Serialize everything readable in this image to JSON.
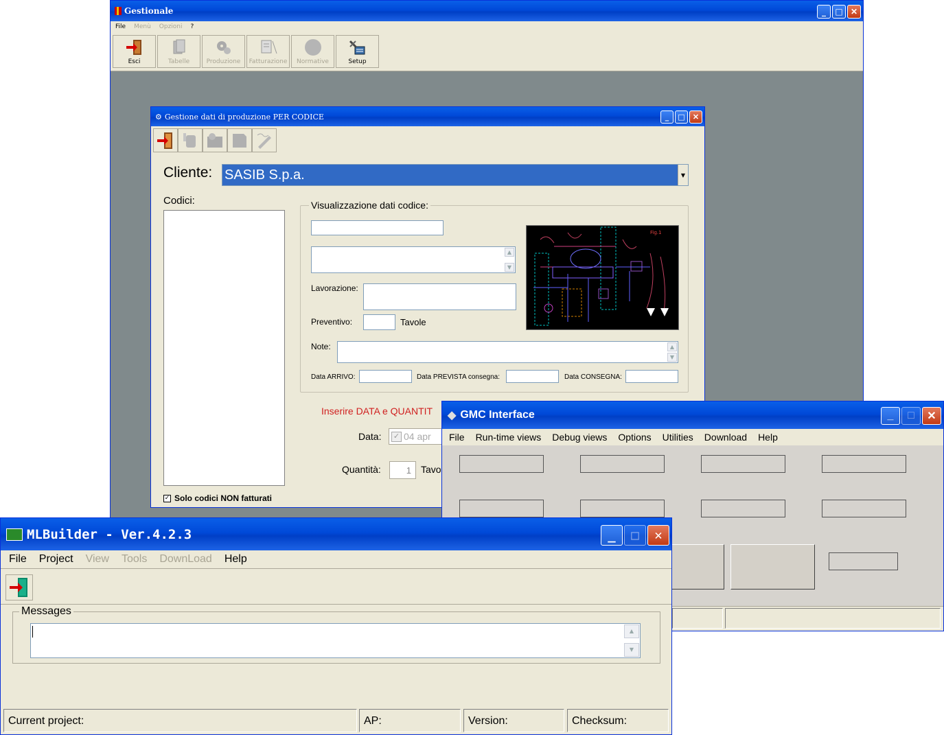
{
  "gestionale": {
    "title": "Gestionale",
    "menu": [
      "File",
      "Menù",
      "Opzioni",
      "?"
    ],
    "toolbar": [
      "Esci",
      "Tabelle",
      "Produzione",
      "Fatturazione",
      "Normative",
      "Setup"
    ]
  },
  "produzione": {
    "title": "Gestione dati di produzione PER CODICE",
    "cliente_label": "Cliente:",
    "cliente_value": "SASIB S.p.a.",
    "codici_label": "Codici:",
    "group_label": "Visualizzazione dati codice:",
    "lavorazione_label": "Lavorazione:",
    "preventivo_label": "Preventivo:",
    "tavole_label": "Tavole",
    "note_label": "Note:",
    "data_arrivo_label": "Data ARRIVO:",
    "data_prevista_label": "Data PREVISTA consegna:",
    "data_consegna_label": "Data CONSEGNA:",
    "inserire_text": "Inserire DATA e QUANTIT",
    "data_label": "Data:",
    "data_value": "04  apr",
    "quantita_label": "Quantità:",
    "quantita_value": "1",
    "tavole2_label": "Tavo",
    "solo_codici_label": "Solo codici NON fatturati",
    "solo_codici_checked": true,
    "drawing_tag": "Fig.1",
    "accent_color": "#316ac5"
  },
  "gmc": {
    "title": "GMC Interface",
    "menu": [
      "File",
      "Run-time views",
      "Debug views",
      "Options",
      "Utilities",
      "Download",
      "Help"
    ]
  },
  "mlbuilder": {
    "title": "MLBuilder - Ver.4.2.3",
    "menu": [
      "File",
      "Project",
      "View",
      "Tools",
      "DownLoad",
      "Help"
    ],
    "messages_label": "Messages",
    "status": {
      "current_project": "Current project:",
      "ap": "AP:",
      "version": "Version:",
      "checksum": "Checksum:"
    }
  }
}
